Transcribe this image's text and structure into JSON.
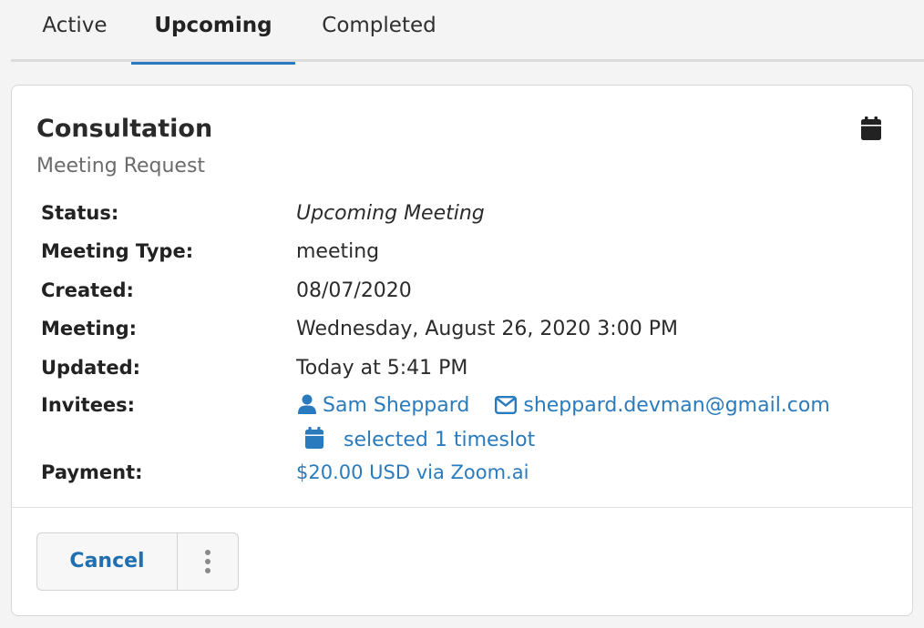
{
  "tabs": [
    {
      "label": "Active"
    },
    {
      "label": "Upcoming"
    },
    {
      "label": "Completed"
    }
  ],
  "active_tab": "Upcoming",
  "card": {
    "title": "Consultation",
    "subtitle": "Meeting Request",
    "header_icon": "calendar-icon",
    "fields": {
      "status": {
        "label": "Status:",
        "value": "Upcoming Meeting"
      },
      "meeting_type": {
        "label": "Meeting Type:",
        "value": "meeting"
      },
      "created": {
        "label": "Created:",
        "value": "08/07/2020"
      },
      "meeting": {
        "label": "Meeting:",
        "value": "Wednesday, August 26, 2020 3:00 PM"
      },
      "updated": {
        "label": "Updated:",
        "value": "Today at 5:41 PM"
      },
      "invitees": {
        "label": "Invitees:",
        "name": "Sam Sheppard",
        "name_icon": "user-icon",
        "email": "sheppard.devman@gmail.com",
        "email_icon": "envelope-icon",
        "timeslot": "selected 1 timeslot",
        "timeslot_icon": "calendar-icon"
      },
      "payment": {
        "label": "Payment:",
        "value": "$20.00 USD via Zoom.ai"
      }
    },
    "actions": {
      "cancel_label": "Cancel",
      "more_icon": "vertical-ellipsis-icon"
    }
  },
  "colors": {
    "accent": "#2a7bbd",
    "link": "#2a7bbd",
    "background": "#f4f4f4",
    "card": "#ffffff"
  }
}
